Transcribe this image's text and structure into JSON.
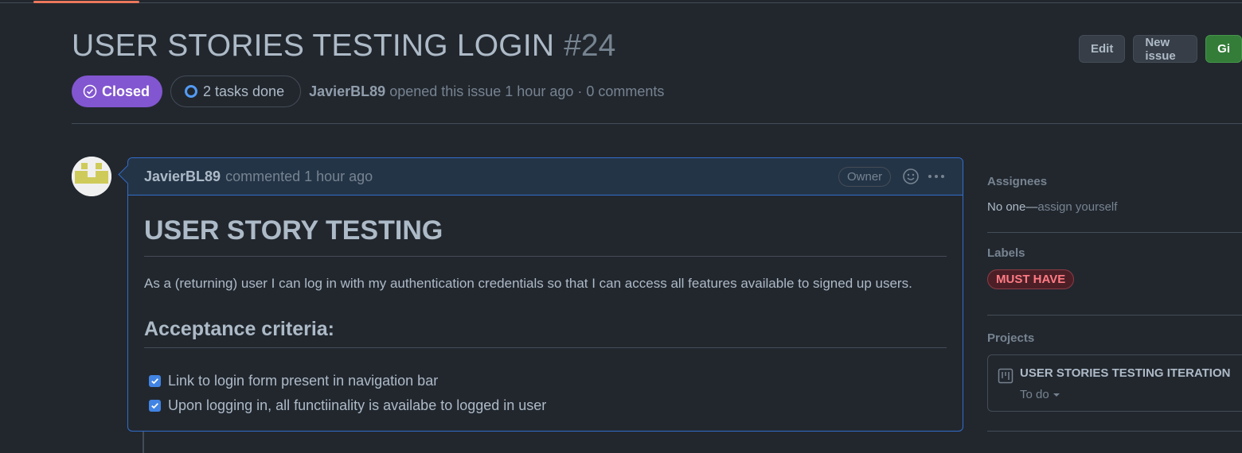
{
  "issue": {
    "title": "USER STORIES TESTING LOGIN",
    "number": "#24",
    "state_label": "Closed",
    "tasks_label": "2 tasks done",
    "author": "JavierBL89",
    "meta": "opened this issue 1 hour ago · 0 comments"
  },
  "header_actions": {
    "edit_label": "Edit",
    "new_issue_label": "New issue",
    "green_label": "Gi"
  },
  "comment": {
    "author": "JavierBL89",
    "time_text": "commented 1 hour ago",
    "role_badge": "Owner",
    "heading": "USER STORY TESTING",
    "paragraph": "As a (returning) user I can log in with my authentication credentials so that I can access all features available to signed up users.",
    "subheading": "Acceptance criteria:",
    "tasks": [
      {
        "text": "Link to login form present in navigation bar",
        "checked": true
      },
      {
        "text": "Upon logging in, all functiinality is availabe to logged in user",
        "checked": true
      }
    ]
  },
  "sidebar": {
    "assignees": {
      "heading": "Assignees",
      "value": "No one—",
      "action": "assign yourself"
    },
    "labels": {
      "heading": "Labels",
      "items": [
        "MUST HAVE"
      ]
    },
    "projects": {
      "heading": "Projects",
      "name": "USER STORIES TESTING ITERATION",
      "status": "To do"
    }
  },
  "colors": {
    "background": "#22272e",
    "closed_badge": "#8256d0",
    "comment_border": "#316dca",
    "label_text": "#ff7b84",
    "primary_button": "#347d39"
  },
  "icons": [
    "check-circle-icon",
    "progress-circle-icon",
    "smiley-icon",
    "kebab-icon",
    "project-board-icon",
    "caret-down-icon",
    "checkbox-checked-icon"
  ]
}
